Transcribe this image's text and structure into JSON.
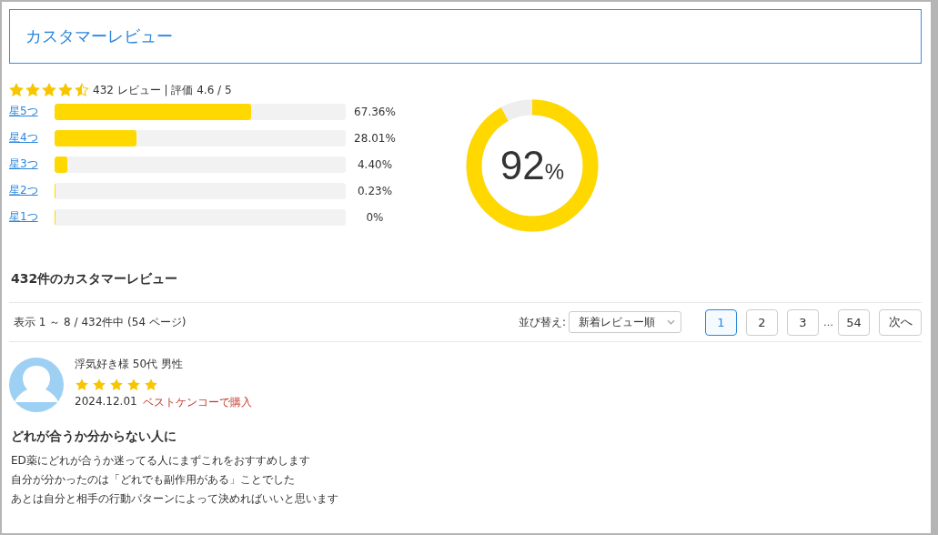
{
  "header": {
    "title": "カスタマーレビュー"
  },
  "summary": {
    "stars": 4.5,
    "text": "432 レビュー | 評価 4.6 / 5"
  },
  "distribution": [
    {
      "label": "星5つ",
      "level": 0.6736,
      "percent": "67.36%"
    },
    {
      "label": "星4つ",
      "level": 0.2801,
      "percent": "28.01%"
    },
    {
      "label": "星3つ",
      "level": 0.044,
      "percent": "4.40%"
    },
    {
      "label": "星2つ",
      "level": 0.0023,
      "percent": "0.23%"
    },
    {
      "label": "星1つ",
      "level": 0,
      "percent": "0%"
    }
  ],
  "donut": {
    "level": 0.92,
    "value": "92",
    "unit": "%"
  },
  "reviews_heading": "432件のカスタマーレビュー",
  "toolbar": {
    "range": "表示 1 ～ 8 / 432件中 (54 ページ)",
    "sort_label": "並び替え:",
    "sort_value": "新着レビュー順",
    "pages": [
      {
        "label": "1",
        "selected": true
      },
      {
        "label": "2",
        "selected": false
      },
      {
        "label": "3",
        "selected": false
      },
      {
        "label": "…",
        "kind": "gap"
      },
      {
        "label": "54",
        "selected": false
      }
    ],
    "next": "次へ"
  },
  "reviews": [
    {
      "author": "浮気好き様 50代 男性",
      "stars": 5,
      "date": "2024.12.01",
      "source": "ベストケンコーで購入",
      "title": "どれが合うか分からない人に",
      "body": [
        "ED薬にどれが合うか迷ってる人にまずこれをおすすめします",
        "自分が分かったのは「どれでも副作用がある」ことでした",
        "あとは自分と相手の行動パターンによって決めればいいと思います"
      ]
    }
  ]
}
